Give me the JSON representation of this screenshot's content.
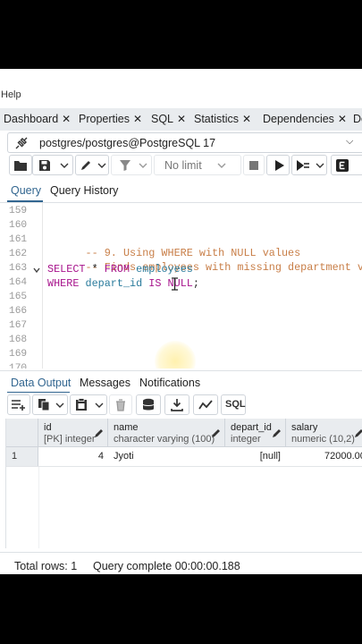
{
  "menu": {
    "help": "Help"
  },
  "tabs": [
    {
      "label": "Dashboard",
      "close": "✕"
    },
    {
      "label": "Properties",
      "close": "✕"
    },
    {
      "label": "SQL",
      "close": "✕"
    },
    {
      "label": "Statistics",
      "close": "✕"
    },
    {
      "label": "Dependencies",
      "close": "✕"
    },
    {
      "label": "De"
    }
  ],
  "connection": {
    "label": "postgres/postgres@PostgreSQL 17"
  },
  "toolbar": {
    "limit_label": "No limit"
  },
  "query_tabs": {
    "query": "Query",
    "history": "Query History"
  },
  "editor": {
    "lines": [
      {
        "num": "159",
        "text": ""
      },
      {
        "num": "160",
        "text": ""
      },
      {
        "num": "161",
        "comment": "-- 9. Using WHERE with NULL values"
      },
      {
        "num": "162",
        "comment": "-- Finds employees with missing department values."
      },
      {
        "num": "163",
        "kw1": "SELECT",
        "op": " * ",
        "kw2": "FROM",
        "table": " employees"
      },
      {
        "num": "164",
        "kw1": "WHERE",
        "col": " depart_id ",
        "kw2": "IS",
        "kw3": " NULL",
        "end": ";"
      },
      {
        "num": "165"
      },
      {
        "num": "166"
      },
      {
        "num": "167"
      },
      {
        "num": "168"
      },
      {
        "num": "169"
      },
      {
        "num": "170"
      }
    ]
  },
  "output_tabs": {
    "data": "Data Output",
    "messages": "Messages",
    "notifications": "Notifications"
  },
  "output_toolbar": {
    "sql_label": "SQL"
  },
  "grid": {
    "columns": [
      {
        "name": "id",
        "type": "[PK] integer"
      },
      {
        "name": "name",
        "type": "character varying (100)"
      },
      {
        "name": "depart_id",
        "type": "integer"
      },
      {
        "name": "salary",
        "type": "numeric (10,2)"
      }
    ],
    "rows": [
      {
        "row": "1",
        "id": "4",
        "name": "Jyoti",
        "depart_id": "[null]",
        "salary": "72000.00"
      }
    ]
  },
  "status": {
    "total_rows": "Total rows: 1",
    "query_status": "Query complete 00:00:00.188"
  },
  "colors": {
    "accent": "#326690",
    "comment": "#c87e47",
    "keyword": "#a7138c",
    "identifier": "#2a7b9c"
  }
}
